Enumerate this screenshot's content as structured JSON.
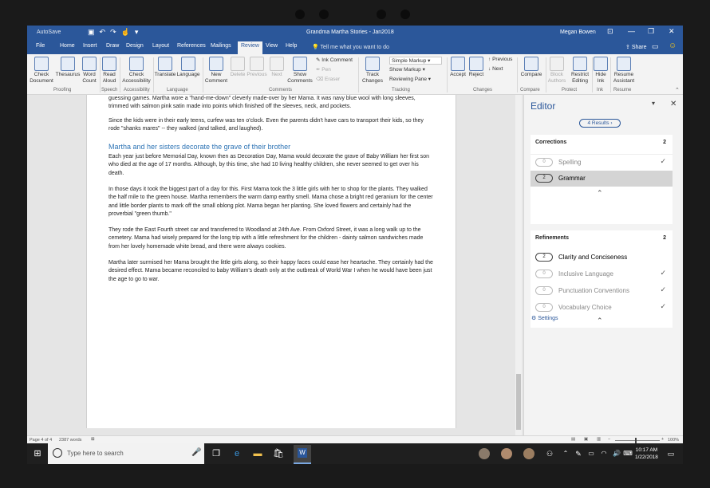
{
  "titlebar": {
    "autosave": "AutoSave",
    "doc_title": "Grandma Martha Stories - Jan2018",
    "user": "Megan Bowen",
    "minimize": "—",
    "restore": "❐",
    "close": "✕",
    "icons": [
      "save-icon",
      "undo-icon",
      "redo-icon",
      "touch-mode-icon"
    ]
  },
  "tabs": [
    "File",
    "Home",
    "Insert",
    "Draw",
    "Design",
    "Layout",
    "References",
    "Mailings",
    "Review",
    "View",
    "Help"
  ],
  "active_tab": "Review",
  "tellme": "Tell me what you want to do",
  "share": "Share",
  "ribbon": {
    "check_document": "Check\nDocument",
    "thesaurus": "Thesaurus",
    "word_count": "Word\nCount",
    "read_aloud": "Read\nAloud",
    "check_accessibility": "Check\nAccessibility",
    "translate": "Translate",
    "language": "Language",
    "new_comment": "New\nComment",
    "delete": "Delete",
    "previous": "Previous",
    "next": "Next",
    "show_comments": "Show\nComments",
    "ink_comment": "Ink Comment",
    "pen": "Pen",
    "eraser": "Eraser",
    "simple_markup": "Simple Markup",
    "show_markup": "Show Markup",
    "reviewing_pane": "Reviewing Pane",
    "track_changes": "Track\nChanges",
    "accept": "Accept",
    "reject": "Reject",
    "prev_change": "Previous",
    "next_change": "Next",
    "compare": "Compare",
    "block_authors": "Block\nAuthors",
    "restrict_editing": "Restrict\nEditing",
    "hide_ink": "Hide\nInk",
    "resume_assistant": "Resume\nAssistant",
    "groups": {
      "proofing": "Proofing",
      "speech": "Speech",
      "accessibility": "Accessibility",
      "language": "Language",
      "comments": "Comments",
      "tracking": "Tracking",
      "changes": "Changes",
      "compare": "Compare",
      "protect": "Protect",
      "ink": "Ink",
      "resume": "Resume"
    }
  },
  "document": {
    "p1": "guessing games. Martha wore a \"hand-me-down\" cleverly made-over by her Mama. It was navy blue wool with long sleeves, trimmed with salmon pink satin made into points which finished off the sleeves, neck, and pockets.",
    "p2": "Since the kids were in their early teens, curfew was ten o'clock. Even the parents didn't have cars to transport their kids, so they rode \"shanks mares\" -- they walked (and talked, and laughed).",
    "heading": "Martha and her sisters decorate the grave of their brother",
    "p3": "Each year just before Memorial Day, known then as Decoration Day, Mama would decorate the grave of Baby William her first son who died at the age of 17 months. Although, by this time, she had 10 living healthy children, she never seemed to get over his death.",
    "p4": "In those days it took the biggest part of a day for this. First Mama took the 3 little girls with her to shop for the plants. They walked the half mile to the green house. Martha remembers the warm damp earthy smell. Mama chose a bright red geranium for the center and little border plants to mark off the small oblong plot. Mama began her planting. She loved flowers and certainly had the proverbial \"green thumb.\"",
    "p5": "They rode the East Fourth street car and transferred to Woodland at 24th Ave. From Oxford Street, it was a long walk up to the cemetery. Mama had wisely prepared for the long trip with a little refreshment for the children - dainty salmon sandwiches made from her lovely homemade white bread, and there were always cookies.",
    "p6": "Martha later surmised her Mama brought the little girls along, so their happy faces could ease her heartache. They certainly had the desired effect. Mama became reconciled to baby William's death only at the outbreak of World War I when he would have been just the age to go to war."
  },
  "editor": {
    "title": "Editor",
    "results": "4 Results ›",
    "corrections": {
      "header": "Corrections",
      "count": "2",
      "items": [
        {
          "label": "Spelling",
          "count": "0",
          "done": "✓"
        },
        {
          "label": "Grammar",
          "count": "2",
          "done": ""
        }
      ]
    },
    "refinements": {
      "header": "Refinements",
      "count": "2",
      "items": [
        {
          "label": "Clarity and Conciseness",
          "count": "2",
          "done": ""
        },
        {
          "label": "Inclusive Language",
          "count": "0",
          "done": "✓"
        },
        {
          "label": "Punctuation Conventions",
          "count": "0",
          "done": "✓"
        },
        {
          "label": "Vocabulary Choice",
          "count": "0",
          "done": "✓"
        }
      ]
    },
    "settings": "Settings"
  },
  "status": {
    "page": "Page 4 of 4",
    "words": "2387 words",
    "zoom": "100%"
  },
  "taskbar": {
    "search_placeholder": "Type here to search",
    "time": "10:17 AM",
    "date": "1/22/2018"
  }
}
